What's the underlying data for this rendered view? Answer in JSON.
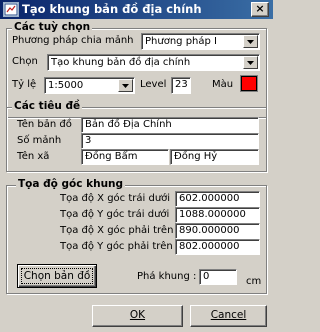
{
  "window": {
    "title": "Tạo khung bản đồ địa chính",
    "close_glyph": "×"
  },
  "options": {
    "group_title": "Các tuỳ chọn",
    "method_label": "Phương pháp chia mảnh",
    "method_value": "Phương pháp I",
    "choose_label": "Chọn",
    "choose_value": "Tạo khung bản đồ địa chính",
    "scale_label": "Tỷ lệ",
    "scale_value": "1:5000",
    "level_label": "Level",
    "level_value": "23",
    "color_label": "Màu",
    "color_value": "#ff0000"
  },
  "headings": {
    "group_title": "Các tiêu đề",
    "map_name_label": "Tên bản đồ",
    "map_name_value": "Bản đồ Địa Chính",
    "sheet_number_label": "Số mảnh",
    "sheet_number_value": "3",
    "commune_label": "Tên xã",
    "commune_value": "Đồng Bẩm",
    "district_value": "Đồng Hỷ"
  },
  "corners": {
    "group_title": "Tọa độ góc khung",
    "x_bottom_left_label": "Tọa độ X góc trái dưới",
    "x_bottom_left_value": "602.000000",
    "y_bottom_left_label": "Tọa độ Y góc trái dưới",
    "y_bottom_left_value": "1088.000000",
    "x_top_right_label": "Tọa độ X góc phải trên",
    "x_top_right_value": "890.000000",
    "y_top_right_label": "Tọa độ Y góc phải trên",
    "y_top_right_value": "802.000000",
    "select_map_button": "Chọn bản đồ",
    "frame_break_label": "Phá khung :",
    "frame_break_value": "0",
    "frame_break_unit": "cm"
  },
  "footer": {
    "ok_label": "OK",
    "cancel_label": "Cancel"
  },
  "icons": {
    "combo_arrow": "chevron-down-icon",
    "app": "map-frame-icon"
  }
}
